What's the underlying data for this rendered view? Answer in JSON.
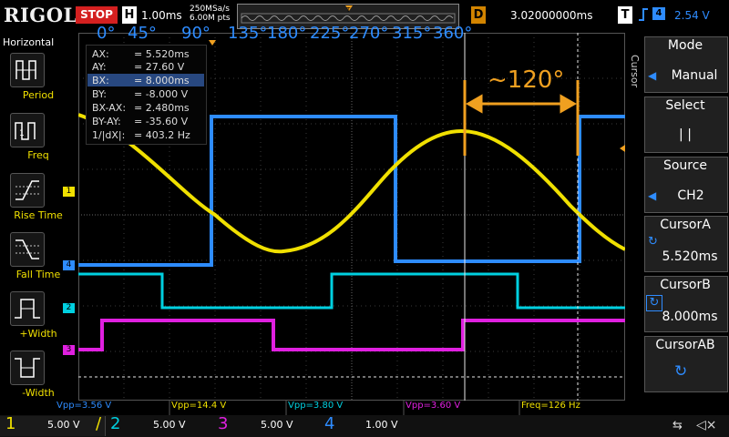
{
  "brand": "RIGOL",
  "run_state": "STOP",
  "horizontal": {
    "key": "H",
    "timebase": "1.00ms",
    "sample_rate": "250MSa/s",
    "memory_depth": "6.00M pts"
  },
  "delay": {
    "key": "D",
    "value": "3.02000000ms"
  },
  "trigger": {
    "key": "T",
    "edge_symbol": "Ʒ",
    "source": "4",
    "level": "2.54 V"
  },
  "left_menu": {
    "title": "Horizontal",
    "items": [
      {
        "label": "Period"
      },
      {
        "label": "Freq"
      },
      {
        "label": "Rise Time"
      },
      {
        "label": "Fall Time"
      },
      {
        "label": "+Width"
      },
      {
        "label": "-Width"
      }
    ]
  },
  "phase_labels": [
    "0°",
    "45°",
    "90°",
    "135°",
    "180°",
    "225°",
    "270°",
    "315°",
    "360°"
  ],
  "annotation": "~120°",
  "cursor_readout": [
    {
      "name": "AX:",
      "value": "=   5.520ms"
    },
    {
      "name": "AY:",
      "value": "=   27.60 V"
    },
    {
      "name": "BX:",
      "value": "=   8.000ms"
    },
    {
      "name": "BY:",
      "value": "=   -8.000 V"
    },
    {
      "name": "BX-AX:",
      "value": "=   2.480ms"
    },
    {
      "name": "BY-AY:",
      "value": "=   -35.60 V"
    },
    {
      "name": "1/|dX|:",
      "value": "=   403.2 Hz"
    }
  ],
  "right_menu": {
    "side_label": "Cursor",
    "mode": {
      "title": "Mode",
      "value": "Manual"
    },
    "select": {
      "title": "Select",
      "value": "|   |"
    },
    "source": {
      "title": "Source",
      "value": "CH2"
    },
    "cursor_a": {
      "title": "CursorA",
      "value": "5.520ms"
    },
    "cursor_b": {
      "title": "CursorB",
      "value": "8.000ms"
    },
    "cursor_ab": {
      "title": "CursorAB",
      "value": ""
    }
  },
  "measurements": [
    {
      "label": "Vpp=3.56 V",
      "color": "#2e8cff"
    },
    {
      "label": "Vpp=14.4 V",
      "color": "#f0e000"
    },
    {
      "label": "Vpp=3.80 V",
      "color": "#00d0e0"
    },
    {
      "label": "Vpp=3.60 V",
      "color": "#e020e0"
    },
    {
      "label": "Freq=126 Hz",
      "color": "#f0e000"
    }
  ],
  "channels": [
    {
      "num": "1",
      "scale": "5.00 V",
      "color": "#f0e000"
    },
    {
      "num": "2",
      "scale": "5.00 V",
      "color": "#00d0e0"
    },
    {
      "num": "3",
      "scale": "5.00 V",
      "color": "#e020e0"
    },
    {
      "num": "4",
      "scale": "1.00 V",
      "color": "#2e8cff"
    }
  ],
  "channel_markers": [
    "1",
    "4",
    "2",
    "3"
  ],
  "colors": {
    "ch1": "#f0e000",
    "ch2": "#00d0e0",
    "ch3": "#e020e0",
    "ch4": "#2e8cff",
    "annotation": "#f0a020",
    "stop": "#d42020"
  }
}
